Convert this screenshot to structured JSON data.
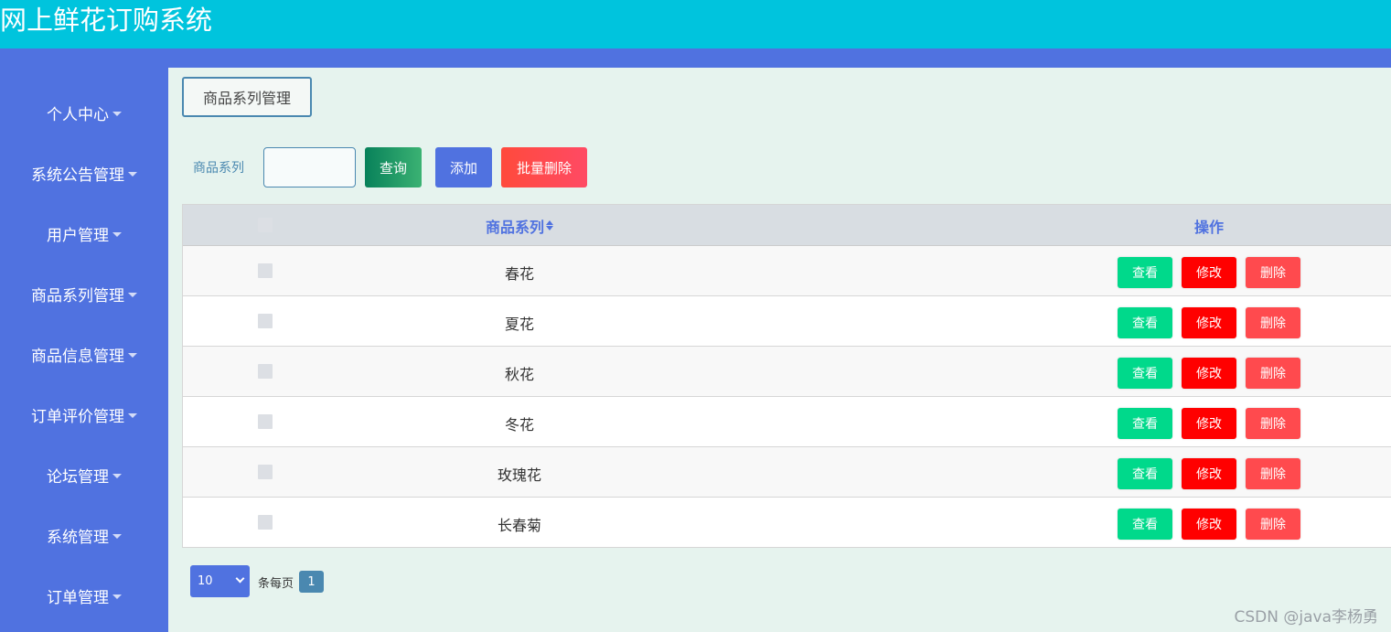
{
  "header": {
    "title": "网上鲜花订购系统"
  },
  "sidebar": {
    "items": [
      {
        "label": "个人中心"
      },
      {
        "label": "系统公告管理"
      },
      {
        "label": "用户管理"
      },
      {
        "label": "商品系列管理"
      },
      {
        "label": "商品信息管理"
      },
      {
        "label": "订单评价管理"
      },
      {
        "label": "论坛管理"
      },
      {
        "label": "系统管理"
      },
      {
        "label": "订单管理"
      }
    ]
  },
  "page": {
    "tab_title": "商品系列管理"
  },
  "search": {
    "label": "商品系列",
    "value": "",
    "query_label": "查询",
    "add_label": "添加",
    "batch_delete_label": "批量删除"
  },
  "table": {
    "columns": [
      "商品系列",
      "操作"
    ],
    "rows": [
      {
        "name": "春花",
        "checked": false
      },
      {
        "name": "夏花",
        "checked": false
      },
      {
        "name": "秋花",
        "checked": false
      },
      {
        "name": "冬花",
        "checked": false
      },
      {
        "name": "玫瑰花",
        "checked": false
      },
      {
        "name": "长春菊",
        "checked": false
      }
    ],
    "actions": {
      "view": "查看",
      "edit": "修改",
      "delete": "删除"
    }
  },
  "pagination": {
    "page_size": "10",
    "per_page_label": "条每页",
    "current_page": "1"
  },
  "watermark": "CSDN @java李杨勇",
  "colors": {
    "topbar": "#00c4dd",
    "sidebar": "#5072e0",
    "content_bg": "#e6f3ee",
    "view": "#00d98b",
    "edit": "#ff0000",
    "delete": "#ff4a4e"
  }
}
